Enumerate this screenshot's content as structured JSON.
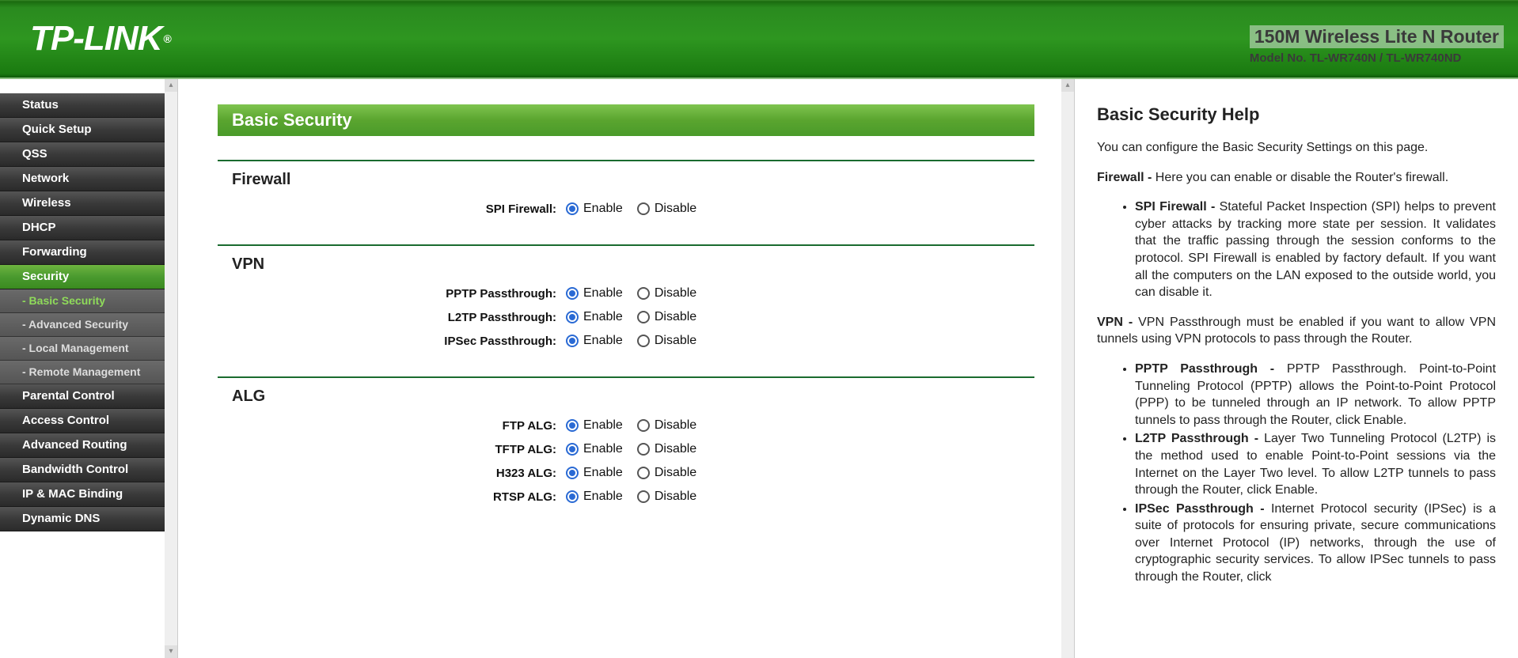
{
  "header": {
    "brand": "TP-LINK",
    "reg": "®",
    "product_title": "150M Wireless Lite N Router",
    "product_model": "Model No. TL-WR740N / TL-WR740ND"
  },
  "nav": {
    "items": [
      {
        "label": "Status",
        "type": "top"
      },
      {
        "label": "Quick Setup",
        "type": "top"
      },
      {
        "label": "QSS",
        "type": "top"
      },
      {
        "label": "Network",
        "type": "top"
      },
      {
        "label": "Wireless",
        "type": "top"
      },
      {
        "label": "DHCP",
        "type": "top"
      },
      {
        "label": "Forwarding",
        "type": "top"
      },
      {
        "label": "Security",
        "type": "top",
        "active": true
      },
      {
        "label": "- Basic Security",
        "type": "sub",
        "active": true
      },
      {
        "label": "- Advanced Security",
        "type": "sub"
      },
      {
        "label": "- Local Management",
        "type": "sub"
      },
      {
        "label": "- Remote Management",
        "type": "sub"
      },
      {
        "label": "Parental Control",
        "type": "top"
      },
      {
        "label": "Access Control",
        "type": "top"
      },
      {
        "label": "Advanced Routing",
        "type": "top"
      },
      {
        "label": "Bandwidth Control",
        "type": "top"
      },
      {
        "label": "IP & MAC Binding",
        "type": "top"
      },
      {
        "label": "Dynamic DNS",
        "type": "top"
      }
    ]
  },
  "content": {
    "page_title": "Basic Security",
    "enable": "Enable",
    "disable": "Disable",
    "sections": [
      {
        "title": "Firewall",
        "rows": [
          {
            "label": "SPI Firewall:",
            "value": "enable"
          }
        ]
      },
      {
        "title": "VPN",
        "rows": [
          {
            "label": "PPTP Passthrough:",
            "value": "enable"
          },
          {
            "label": "L2TP Passthrough:",
            "value": "enable"
          },
          {
            "label": "IPSec Passthrough:",
            "value": "enable"
          }
        ]
      },
      {
        "title": "ALG",
        "rows": [
          {
            "label": "FTP ALG:",
            "value": "enable"
          },
          {
            "label": "TFTP ALG:",
            "value": "enable"
          },
          {
            "label": "H323 ALG:",
            "value": "enable"
          },
          {
            "label": "RTSP ALG:",
            "value": "enable"
          }
        ]
      }
    ]
  },
  "help": {
    "title": "Basic Security Help",
    "intro": "You can configure the Basic Security Settings on this page.",
    "firewall_label": "Firewall - ",
    "firewall_text": "Here you can enable or disable the Router's firewall.",
    "spi_label": "SPI Firewall - ",
    "spi_text": "Stateful Packet Inspection (SPI) helps to prevent cyber attacks by tracking more state per session. It validates that the traffic passing through the session conforms to the protocol. SPI Firewall is enabled by factory default. If you want all the computers on the LAN exposed to the outside world, you can disable it.",
    "vpn_label": "VPN - ",
    "vpn_text": "VPN Passthrough must be enabled if you want to allow VPN tunnels using VPN protocols to pass through the Router.",
    "pptp_label": "PPTP Passthrough - ",
    "pptp_text": "PPTP Passthrough. Point-to-Point Tunneling Protocol (PPTP) allows the Point-to-Point Protocol (PPP) to be tunneled through an IP network. To allow PPTP tunnels to pass through the Router, click Enable.",
    "l2tp_label": "L2TP Passthrough - ",
    "l2tp_text": "Layer Two Tunneling Protocol (L2TP) is the method used to enable Point-to-Point sessions via the Internet on the Layer Two level. To allow L2TP tunnels to pass through the Router, click Enable.",
    "ipsec_label": "IPSec Passthrough - ",
    "ipsec_text": "Internet Protocol security (IPSec) is a suite of protocols for ensuring private, secure communications over Internet Protocol (IP) networks, through the use of cryptographic security services. To allow IPSec tunnels to pass through the Router, click"
  }
}
